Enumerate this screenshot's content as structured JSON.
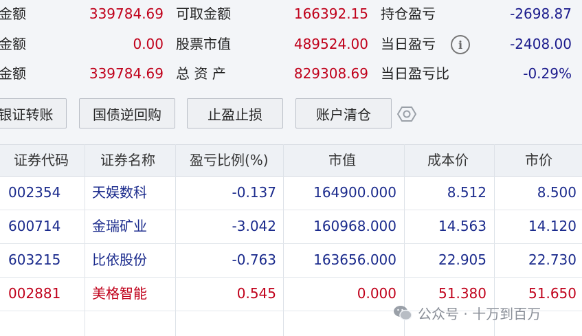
{
  "summary": {
    "col1": [
      {
        "label": "金额",
        "value": "339784.69"
      },
      {
        "label": "金额",
        "value": "0.00"
      },
      {
        "label": "金额",
        "value": "339784.69"
      }
    ],
    "col2": [
      {
        "label": "可取金额",
        "value": "166392.15"
      },
      {
        "label": "股票市值",
        "value": "489524.00"
      },
      {
        "label": "总 资 产",
        "value": "829308.69"
      }
    ],
    "col3": [
      {
        "label": "持仓盈亏",
        "value": "-2698.87"
      },
      {
        "label": "当日盈亏",
        "value": "-2408.00"
      },
      {
        "label": "当日盈亏比",
        "value": "-0.29%"
      }
    ],
    "info_icon": "info-icon"
  },
  "toolbar": {
    "buttons": [
      "银证转账",
      "国债逆回购",
      "止盈止损",
      "账户清仓"
    ],
    "gear_icon": "gear-icon"
  },
  "table": {
    "headers": [
      "证券代码",
      "证券名称",
      "盈亏比例(%)",
      "市值",
      "成本价",
      "市价"
    ],
    "rows": [
      {
        "code": "002354",
        "name": "天娱数科",
        "pnl_ratio": "-0.137",
        "market_value": "164900.000",
        "cost": "8.512",
        "price": "8.500",
        "status": "normal"
      },
      {
        "code": "600714",
        "name": "金瑞矿业",
        "pnl_ratio": "-3.042",
        "market_value": "160968.000",
        "cost": "14.563",
        "price": "14.120",
        "status": "normal"
      },
      {
        "code": "603215",
        "name": "比依股份",
        "pnl_ratio": "-0.763",
        "market_value": "163656.000",
        "cost": "22.905",
        "price": "22.730",
        "status": "normal"
      },
      {
        "code": "002881",
        "name": "美格智能",
        "pnl_ratio": "0.545",
        "market_value": "0.000",
        "cost": "51.380",
        "price": "51.650",
        "status": "up"
      }
    ]
  },
  "watermark": {
    "text": "公众号 · 十万到百万"
  },
  "colors": {
    "loss": "#1a1a8c",
    "gain": "#c0001a",
    "background": "#f3f5f8"
  }
}
